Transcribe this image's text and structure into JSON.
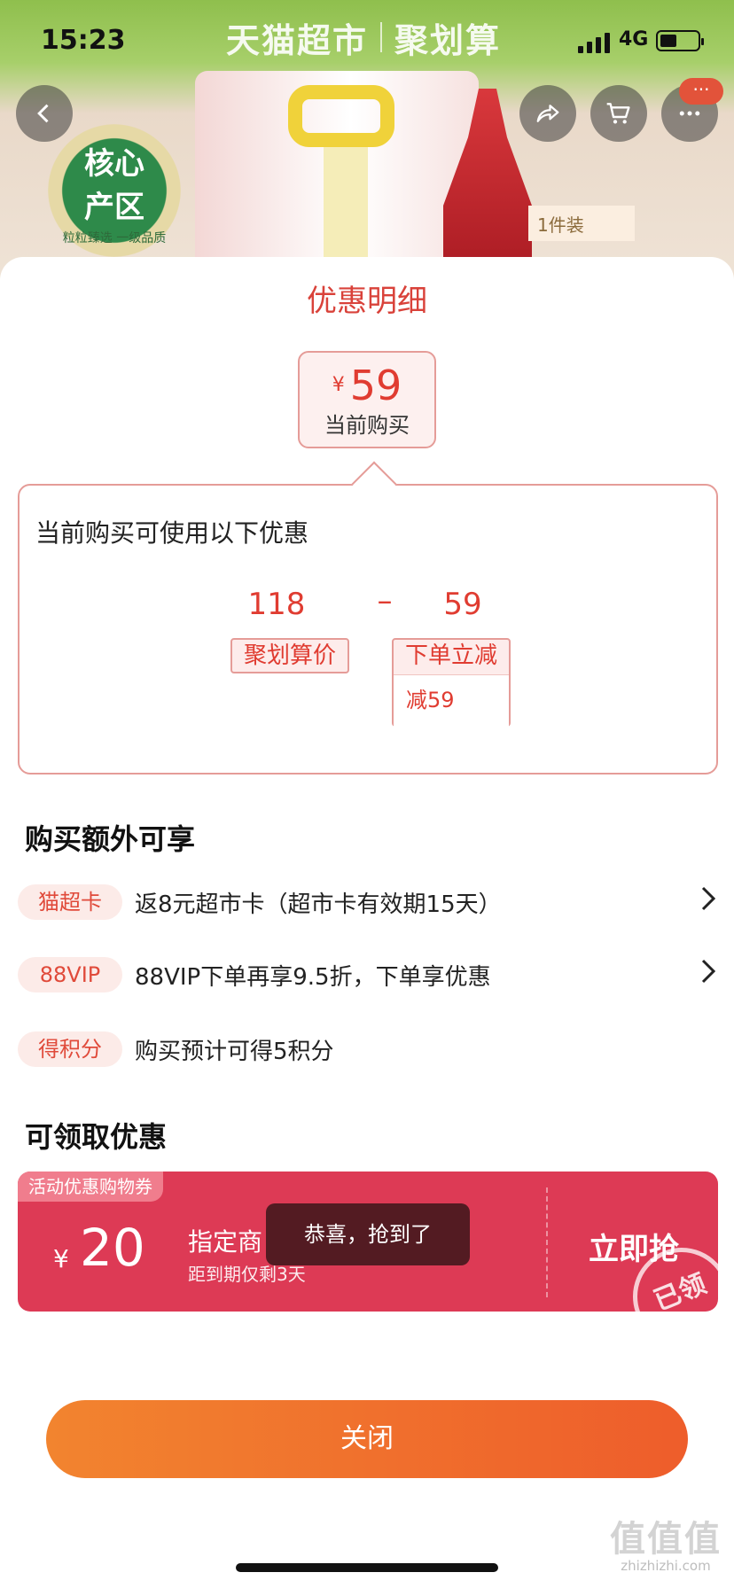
{
  "status_bar": {
    "time": "15:23",
    "network": "4G"
  },
  "banner": {
    "title_left": "天猫超市",
    "title_right": "聚划算",
    "seal_line1": "核心",
    "seal_line2": "产区",
    "seal_line3": "粒粒臻选 一级品质",
    "pack_tag": "1件装",
    "more_badge": "···"
  },
  "sheet": {
    "title": "优惠明细",
    "current_price": {
      "currency": "¥",
      "value": "59",
      "label": "当前购买"
    },
    "details": {
      "heading": "当前购买可使用以下优惠",
      "original_price": "118",
      "operator": "–",
      "discount_amount": "59",
      "original_tag": "聚划算价",
      "discount_tag": "下单立减",
      "discount_sub": "减59"
    },
    "extra_heading": "购买额外可享",
    "perks": [
      {
        "tag": "猫超卡",
        "text": "返8元超市卡（超市卡有效期15天）"
      },
      {
        "tag": "88VIP",
        "text": "88VIP下单再享9.5折，下单享优惠"
      },
      {
        "tag": "得积分",
        "text": "购买预计可得5积分"
      }
    ],
    "coupon_heading": "可领取优惠",
    "coupon": {
      "ribbon": "活动优惠购物券",
      "currency": "¥",
      "value": "20",
      "name": "指定商",
      "expiry": "距到期仅剩3天",
      "action": "立即抢",
      "stamp": "已领"
    },
    "toast": "恭喜，抢到了",
    "close_label": "关闭"
  },
  "watermark": {
    "logo": "值值值",
    "url": "zhizhizhi.com"
  }
}
